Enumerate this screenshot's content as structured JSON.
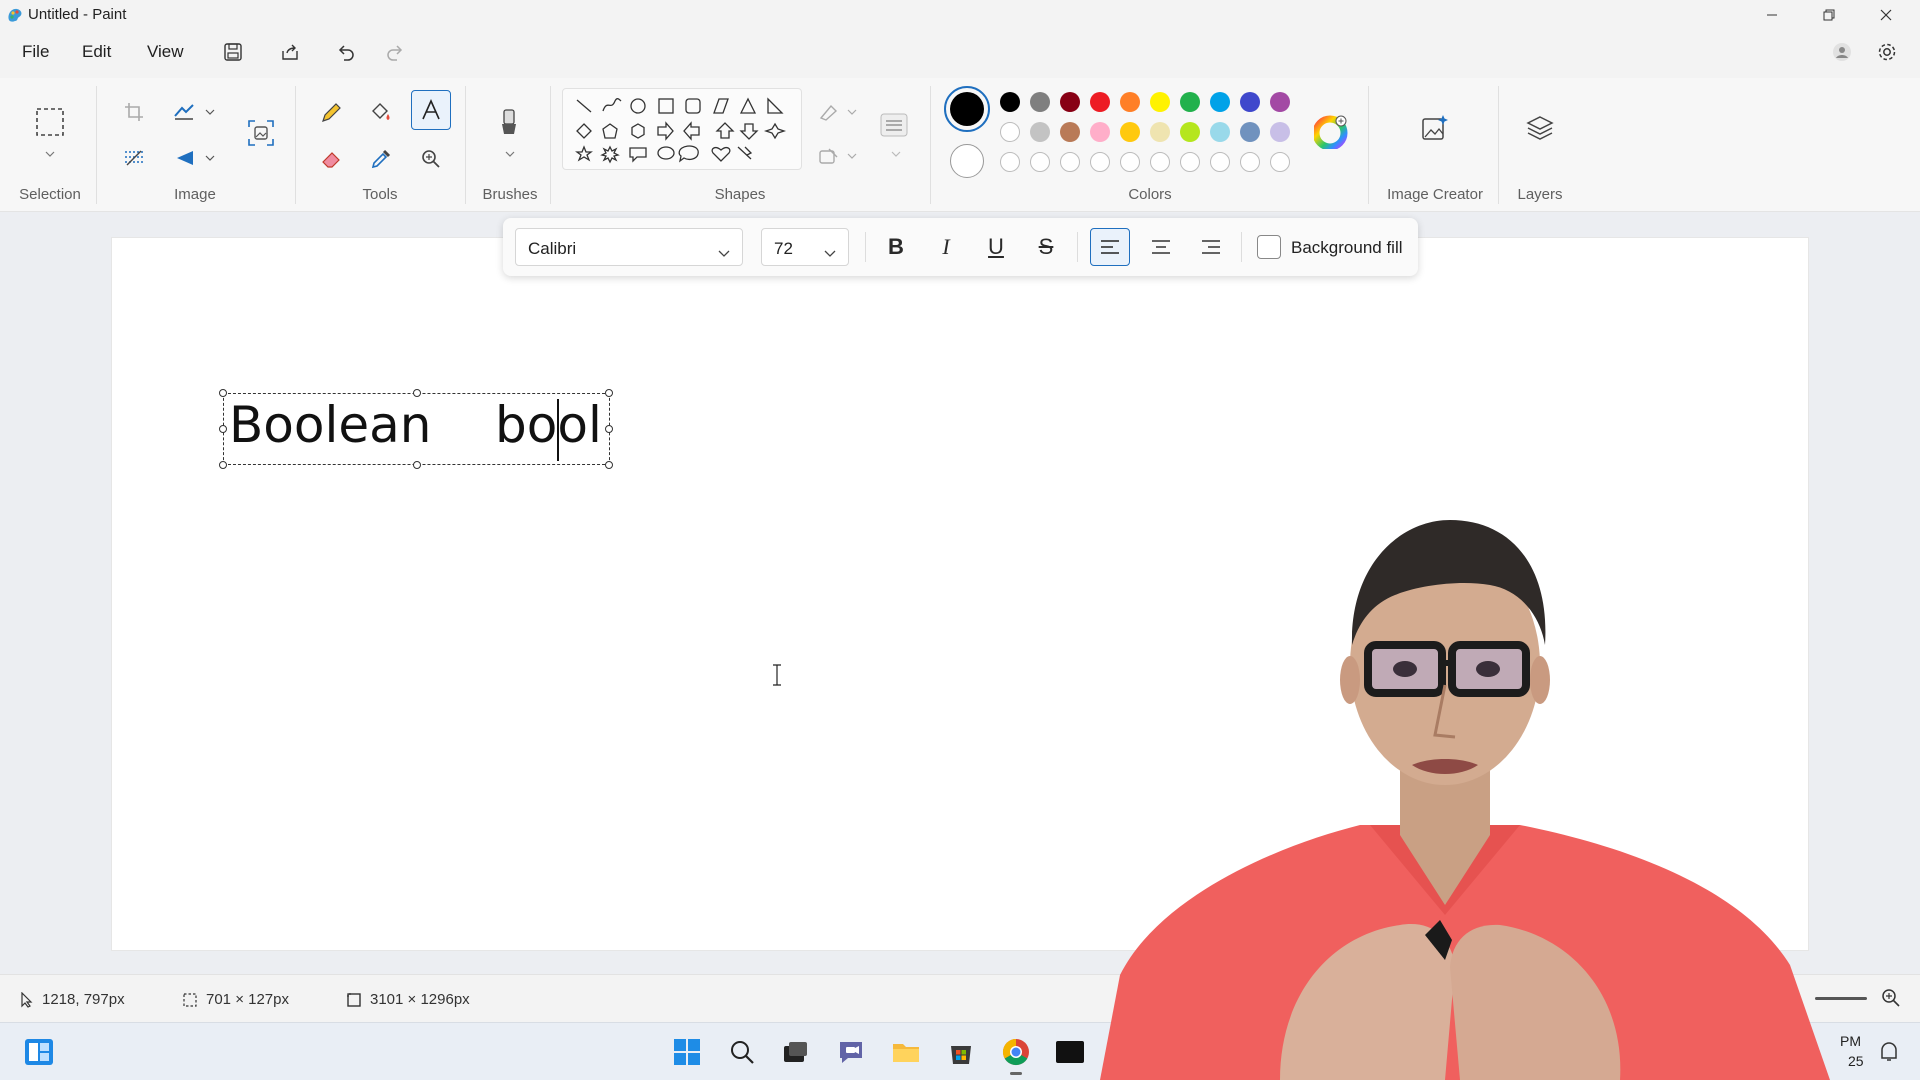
{
  "window": {
    "title": "Untitled - Paint",
    "controls": [
      "minimize",
      "restore",
      "close"
    ]
  },
  "menu": {
    "items": [
      "File",
      "Edit",
      "View"
    ],
    "quick_actions": [
      "save-icon",
      "share-icon",
      "undo-icon",
      "redo-icon"
    ],
    "right_icons": [
      "account-icon",
      "settings-icon"
    ]
  },
  "ribbon": {
    "groups": {
      "selection": "Selection",
      "image": "Image",
      "tools": "Tools",
      "brushes": "Brushes",
      "shapes": "Shapes",
      "colors": "Colors",
      "image_creator": "Image Creator",
      "layers": "Layers"
    },
    "colors": {
      "primary": "#000000",
      "secondary": "#ffffff",
      "palette_row1": [
        "#000000",
        "#7f7f7f",
        "#880015",
        "#ed1c24",
        "#ff7f27",
        "#fff200",
        "#22b14c",
        "#00a2e8",
        "#3f48cc",
        "#a349a4"
      ],
      "palette_row2": [
        "#ffffff",
        "#c3c3c3",
        "#b97a57",
        "#ffaec9",
        "#ffc90e",
        "#efe4b0",
        "#b5e61d",
        "#99d9ea",
        "#7092be",
        "#c8bfe7"
      ],
      "palette_row3": [
        "empty",
        "empty",
        "empty",
        "empty",
        "empty",
        "empty",
        "empty",
        "empty",
        "empty",
        "empty"
      ]
    }
  },
  "text_toolbar": {
    "font": "Calibri",
    "size": "72",
    "bold": "B",
    "italic": "I",
    "underline": "U",
    "strikethrough": "S",
    "background_fill": "Background fill",
    "alignment_selected": "left"
  },
  "canvas": {
    "text": "Boolean    bool"
  },
  "status": {
    "cursor_position": "1218, 797px",
    "selection_size": "701 × 127px",
    "canvas_size": "3101 × 1296px"
  },
  "taskbar": {
    "clock_partial": "PM",
    "date_partial": "25"
  }
}
